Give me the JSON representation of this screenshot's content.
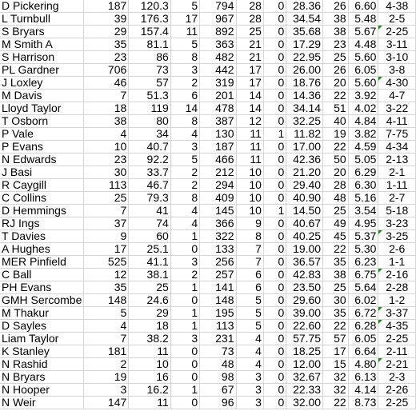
{
  "sheet": {
    "comment_flag_color": "#1e8c1e",
    "rows": [
      [
        "D Pickering",
        "187",
        "120.3",
        "5",
        "794",
        "28",
        "0",
        "28.36",
        "26",
        "6.60",
        "4-38",
        false
      ],
      [
        "L Turnbull",
        "39",
        "176.3",
        "17",
        "967",
        "28",
        "0",
        "34.54",
        "38",
        "5.48",
        "2-5",
        false
      ],
      [
        "S Bryars",
        "29",
        "157.4",
        "11",
        "892",
        "25",
        "0",
        "35.68",
        "38",
        "5.67",
        "2-25",
        true
      ],
      [
        "M Smith A",
        "35",
        "81.1",
        "5",
        "363",
        "21",
        "0",
        "17.29",
        "23",
        "4.48",
        "3-11",
        false
      ],
      [
        "S Harrison",
        "23",
        "86",
        "8",
        "482",
        "21",
        "0",
        "22.95",
        "25",
        "5.60",
        "3-10",
        false
      ],
      [
        "PL Gardner",
        "706",
        "73",
        "3",
        "442",
        "17",
        "0",
        "26.00",
        "26",
        "6.05",
        "3-8",
        false
      ],
      [
        "J Loxley",
        "46",
        "57",
        "2",
        "319",
        "17",
        "0",
        "18.76",
        "20",
        "5.60",
        "4-30",
        true
      ],
      [
        "M Davis",
        "7",
        "51.3",
        "6",
        "201",
        "14",
        "0",
        "14.36",
        "22",
        "3.92",
        "4-7",
        false
      ],
      [
        "Lloyd Taylor",
        "18",
        "119",
        "14",
        "478",
        "14",
        "0",
        "34.14",
        "51",
        "4.02",
        "3-22",
        false
      ],
      [
        "T Osborn",
        "38",
        "80",
        "8",
        "387",
        "12",
        "0",
        "32.25",
        "40",
        "4.84",
        "4-11",
        false
      ],
      [
        "P Vale",
        "4",
        "34",
        "4",
        "130",
        "11",
        "1",
        "11.82",
        "19",
        "3.82",
        "7-75",
        false
      ],
      [
        "P Evans",
        "10",
        "40.7",
        "3",
        "187",
        "11",
        "0",
        "17.00",
        "22",
        "4.59",
        "4-34",
        false
      ],
      [
        "N Edwards",
        "23",
        "92.2",
        "5",
        "466",
        "11",
        "0",
        "42.36",
        "50",
        "5.05",
        "2-13",
        false
      ],
      [
        "J Basi",
        "30",
        "33.7",
        "2",
        "212",
        "10",
        "0",
        "21.20",
        "20",
        "6.29",
        "2-1",
        false
      ],
      [
        "R Caygill",
        "113",
        "46.7",
        "2",
        "294",
        "10",
        "0",
        "29.40",
        "28",
        "6.30",
        "1-11",
        false
      ],
      [
        "C Collins",
        "25",
        "79.3",
        "8",
        "409",
        "10",
        "0",
        "40.90",
        "48",
        "5.16",
        "2-7",
        false
      ],
      [
        "D Hemmings",
        "7",
        "41",
        "4",
        "145",
        "10",
        "1",
        "14.50",
        "25",
        "3.54",
        "5-18",
        false
      ],
      [
        "RJ Ings",
        "37",
        "74",
        "4",
        "366",
        "9",
        "0",
        "40.67",
        "49",
        "4.95",
        "3-23",
        false
      ],
      [
        "T Davies",
        "9",
        "60",
        "1",
        "322",
        "8",
        "0",
        "40.25",
        "45",
        "5.37",
        "3-25",
        true
      ],
      [
        "A Hughes",
        "17",
        "25.1",
        "0",
        "133",
        "7",
        "0",
        "19.00",
        "22",
        "5.30",
        "2-6",
        false
      ],
      [
        "MER Pinfield",
        "525",
        "41.1",
        "3",
        "256",
        "7",
        "0",
        "36.57",
        "35",
        "6.23",
        "1-1",
        false
      ],
      [
        "C Ball",
        "12",
        "38.1",
        "2",
        "257",
        "6",
        "0",
        "42.83",
        "38",
        "6.75",
        "2-16",
        true
      ],
      [
        "PH Evans",
        "35",
        "25",
        "1",
        "141",
        "6",
        "0",
        "23.50",
        "25",
        "5.64",
        "2-28",
        false
      ],
      [
        "GMH Sercombe",
        "148",
        "24.6",
        "0",
        "148",
        "5",
        "0",
        "29.60",
        "30",
        "6.02",
        "1-2",
        false
      ],
      [
        "M Thakur",
        "5",
        "29",
        "1",
        "195",
        "5",
        "0",
        "39.00",
        "35",
        "6.72",
        "3-37",
        true
      ],
      [
        "D Sayles",
        "4",
        "18",
        "1",
        "113",
        "5",
        "0",
        "22.60",
        "22",
        "6.28",
        "4-35",
        true
      ],
      [
        "Liam Taylor",
        "7",
        "38.2",
        "3",
        "231",
        "4",
        "0",
        "57.75",
        "57",
        "6.05",
        "2-25",
        false
      ],
      [
        "K Stanley",
        "181",
        "11",
        "0",
        "73",
        "4",
        "0",
        "18.25",
        "17",
        "6.64",
        "2-11",
        false
      ],
      [
        "N Rashid",
        "2",
        "10",
        "0",
        "48",
        "4",
        "0",
        "12.00",
        "15",
        "4.80",
        "2-21",
        true
      ],
      [
        "N Bryars",
        "19",
        "16",
        "0",
        "98",
        "3",
        "0",
        "32.67",
        "32",
        "6.13",
        "2-3",
        false
      ],
      [
        "N Hooper",
        "3",
        "16.2",
        "1",
        "67",
        "3",
        "0",
        "22.33",
        "32",
        "4.14",
        "2-26",
        false
      ],
      [
        "N Weir",
        "147",
        "11",
        "0",
        "96",
        "3",
        "0",
        "32.00",
        "22",
        "8.73",
        "2-25",
        false
      ]
    ]
  }
}
